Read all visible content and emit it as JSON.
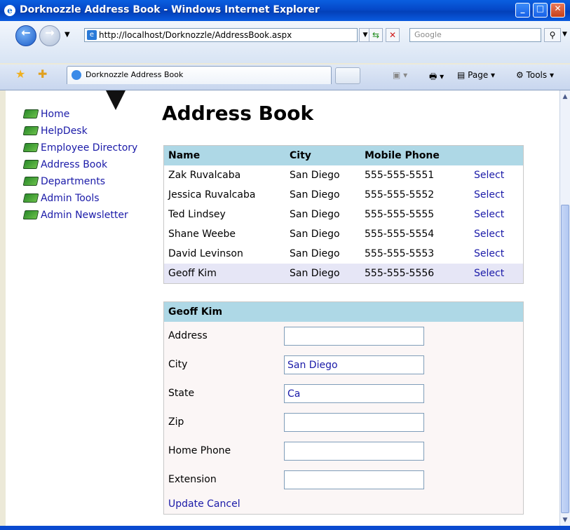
{
  "window": {
    "title": "Dorknozzle Address Book - Windows Internet Explorer"
  },
  "toolbar": {
    "url": "http://localhost/Dorknozzle/AddressBook.aspx",
    "search_placeholder": "Google",
    "tab_title": "Dorknozzle Address Book",
    "page_label": "Page",
    "tools_label": "Tools"
  },
  "nav": {
    "items": [
      {
        "label": "Home"
      },
      {
        "label": "HelpDesk"
      },
      {
        "label": "Employee Directory"
      },
      {
        "label": "Address Book"
      },
      {
        "label": "Departments"
      },
      {
        "label": "Admin Tools"
      },
      {
        "label": "Admin Newsletter"
      }
    ]
  },
  "page": {
    "title": "Address Book"
  },
  "grid": {
    "columns": [
      "Name",
      "City",
      "Mobile Phone"
    ],
    "select_label": "Select",
    "rows": [
      {
        "name": "Zak Ruvalcaba",
        "city": "San Diego",
        "phone": "555-555-5551"
      },
      {
        "name": "Jessica Ruvalcaba",
        "city": "San Diego",
        "phone": "555-555-5552"
      },
      {
        "name": "Ted Lindsey",
        "city": "San Diego",
        "phone": "555-555-5555"
      },
      {
        "name": "Shane Weebe",
        "city": "San Diego",
        "phone": "555-555-5554"
      },
      {
        "name": "David Levinson",
        "city": "San Diego",
        "phone": "555-555-5553"
      },
      {
        "name": "Geoff Kim",
        "city": "San Diego",
        "phone": "555-555-5556"
      }
    ],
    "selected_index": 5
  },
  "details": {
    "header": "Geoff Kim",
    "fields": [
      {
        "label": "Address",
        "value": ""
      },
      {
        "label": "City",
        "value": "San Diego"
      },
      {
        "label": "State",
        "value": "Ca"
      },
      {
        "label": "Zip",
        "value": ""
      },
      {
        "label": "Home Phone",
        "value": ""
      },
      {
        "label": "Extension",
        "value": ""
      }
    ],
    "update_label": "Update",
    "cancel_label": "Cancel"
  },
  "colors": {
    "header_bg": "#aed8e6",
    "link": "#1a1aa8",
    "selected_row": "#e6e6f6"
  }
}
